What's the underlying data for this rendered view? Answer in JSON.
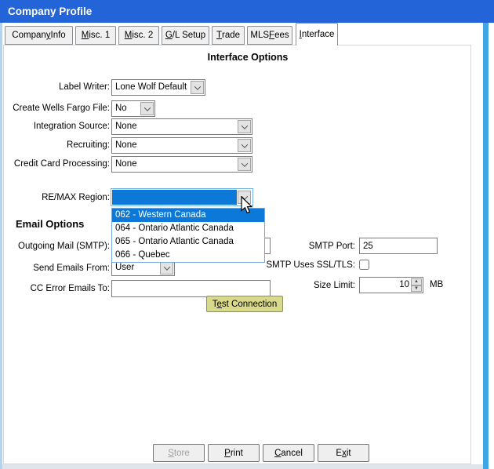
{
  "window": {
    "title": "Company Profile"
  },
  "colors": {
    "titlebar_blue": "#2365d9",
    "selection_blue": "#0c78d8",
    "focus_ring_blue": "#6fb2e4",
    "test_button_yellow": "#d9d98c"
  },
  "tabs": [
    {
      "pre": "Compan",
      "mn": "y",
      "post": " Info"
    },
    {
      "pre": "",
      "mn": "M",
      "post": "isc. 1"
    },
    {
      "pre": "",
      "mn": "M",
      "post": "isc. 2"
    },
    {
      "pre": "",
      "mn": "G",
      "post": "/L Setup"
    },
    {
      "pre": "",
      "mn": "T",
      "post": "rade"
    },
    {
      "pre": "MLS ",
      "mn": "F",
      "post": "ees"
    },
    {
      "pre": "",
      "mn": "I",
      "post": "nterface"
    }
  ],
  "selected_tab": "Interface",
  "heading": "Interface Options",
  "fields": {
    "label_writer": {
      "label": "Label Writer:",
      "value": "Lone Wolf Default"
    },
    "wells_fargo": {
      "label": "Create Wells Fargo File:",
      "value": "No"
    },
    "integration_source": {
      "label": "Integration Source:",
      "value": "None"
    },
    "recruiting": {
      "label": "Recruiting:",
      "value": "None"
    },
    "credit_card": {
      "label": "Credit Card Processing:",
      "value": "None"
    },
    "remax_region": {
      "label": "RE/MAX Region:",
      "value": ""
    }
  },
  "remax_dropdown": {
    "options": [
      "062 - Western Canada",
      "064 - Ontario Atlantic Canada",
      "065 - Ontario Atlantic Canada",
      "066 - Quebec"
    ],
    "highlighted_option": "062 - Western Canada"
  },
  "email": {
    "heading": "Email Options",
    "outgoing_mail": {
      "label": "Outgoing Mail (SMTP):",
      "value": ""
    },
    "send_from": {
      "label": "Send Emails From:",
      "value": "User"
    },
    "cc_error": {
      "label": "CC Error Emails To:",
      "value": ""
    },
    "smtp_port": {
      "label": "SMTP Port:",
      "value": "25"
    },
    "ssl": {
      "label": "SMTP Uses SSL/TLS:",
      "checked": false
    },
    "size_limit": {
      "label": "Size Limit:",
      "value": "10",
      "unit": "MB"
    },
    "test_button": {
      "pre": "T",
      "mn": "e",
      "post": "st Connection"
    }
  },
  "buttons": {
    "store": {
      "pre": "",
      "mn": "S",
      "post": "tore",
      "enabled": false
    },
    "print": {
      "pre": "",
      "mn": "P",
      "post": "rint",
      "enabled": true
    },
    "cancel": {
      "pre": "",
      "mn": "C",
      "post": "ancel",
      "enabled": true
    },
    "exit": {
      "pre": "E",
      "mn": "x",
      "post": "it",
      "enabled": true
    }
  }
}
